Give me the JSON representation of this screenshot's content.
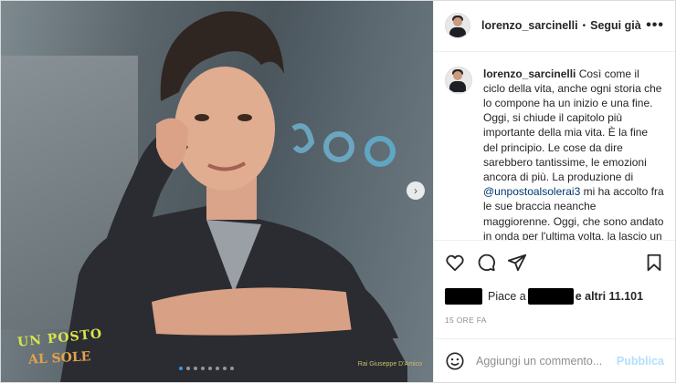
{
  "post": {
    "image": {
      "logo_line1": "UN POSTO",
      "logo_line2": "AL SOLE",
      "credit": "Rai Giuseppe D'Amico",
      "slide_count": 8,
      "active_slide": 1
    },
    "header": {
      "username": "lorenzo_sarcinelli",
      "separator": "•",
      "follow_label": "Segui già",
      "more_icon": "more-horizontal-icon"
    },
    "caption": {
      "username": "lorenzo_sarcinelli",
      "text_before": "Così come il ciclo della vita, anche ogni storia che lo compone ha un inizio e una fine. Oggi, si chiude il capitolo più importante della mia vita. È la fine del principio. Le cose da dire sarebbero tantissime, le emozioni ancora di più. La produzione di ",
      "mention": "@unpostoalsolerai3",
      "text_after": " mi ha accolto fra le sue braccia neanche maggiorenne. Oggi, che sono andato in onda per l'ultima volta, la lascio un po' più uomo. La lascio con la consapevolezza di essere un"
    },
    "actions": {
      "like_icon": "heart-icon",
      "comment_icon": "comment-icon",
      "share_icon": "send-icon",
      "save_icon": "bookmark-icon"
    },
    "likes": {
      "prefix": "Piace a",
      "suffix": "e altri 11.101"
    },
    "timestamp": "15 ORE FA",
    "comment_box": {
      "placeholder": "Aggiungi un commento...",
      "publish_label": "Pubblica",
      "emoji_icon": "emoji-icon"
    }
  }
}
